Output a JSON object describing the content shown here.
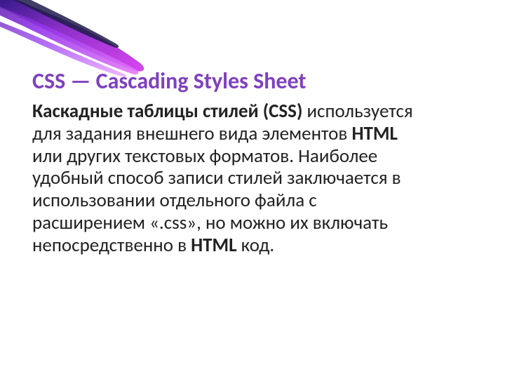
{
  "title": "CSS — Cascading Styles Sheet",
  "body": {
    "lead": "Каскадные таблицы стилей (CSS)",
    "t1": " используется для задания внешнего вида элементов ",
    "html1": "HTML",
    "t2": " или других текстовых форматов. Наиболее удобный способ записи стилей заключается в использовании отдельного файла с расширением «.css», но можно их включать непосредственно в ",
    "html2": "HTML",
    "t3": " код."
  }
}
